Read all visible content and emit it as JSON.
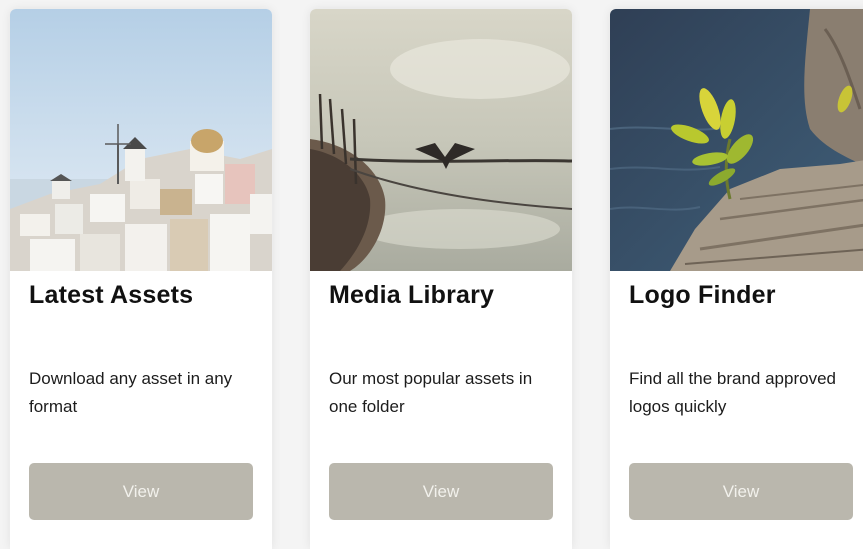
{
  "cards": [
    {
      "image": "santorini-village-photo",
      "title": "Latest Assets",
      "description": "Download any asset in any format",
      "button_label": "View"
    },
    {
      "image": "bird-on-boat-photo",
      "title": "Media Library",
      "description": "Our most popular assets in one folder",
      "button_label": "View"
    },
    {
      "image": "plant-on-rock-photo",
      "title": "Logo Finder",
      "description": "Find all the brand approved logos quickly",
      "button_label": "View"
    }
  ],
  "colors": {
    "page_background": "#f4f4f4",
    "card_background": "#ffffff",
    "button_background": "#bab7ad",
    "button_text": "#f2f1ec",
    "title_text": "#111111"
  }
}
